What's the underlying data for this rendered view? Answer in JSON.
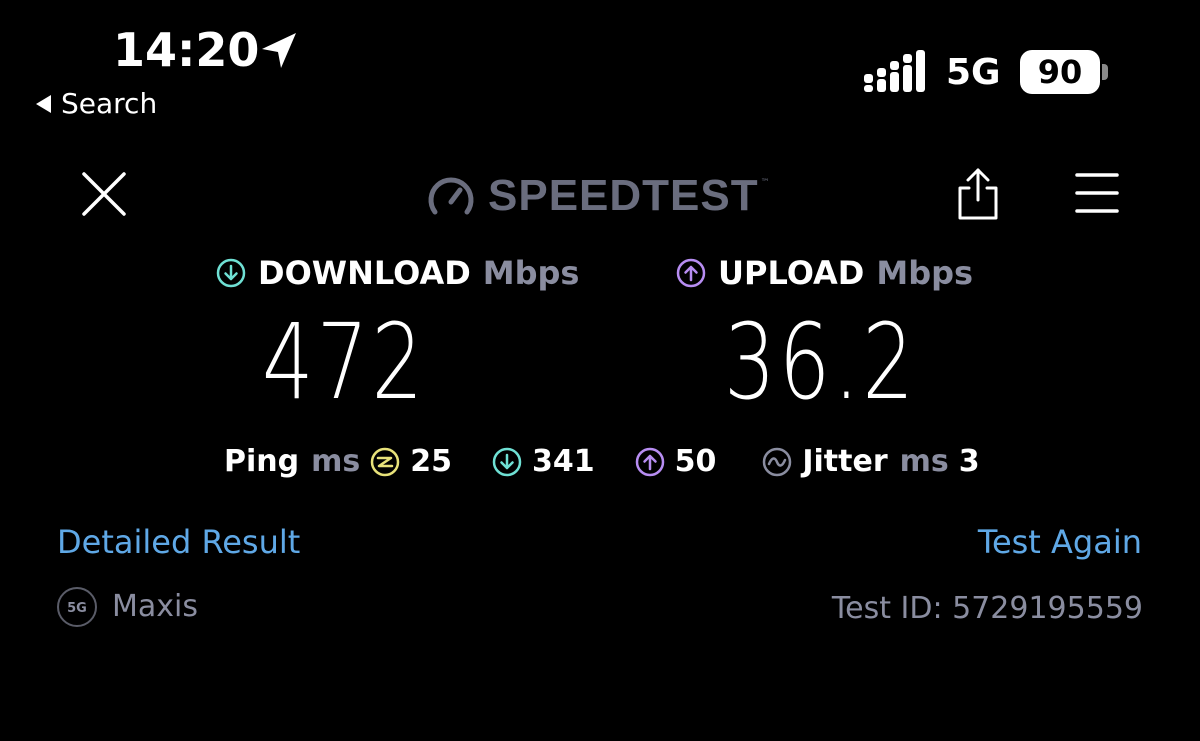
{
  "status_bar": {
    "time": "14:20",
    "back_label": "Search",
    "network": "5G",
    "battery": "90"
  },
  "toolbar": {
    "logo_text": "SPEEDTEST",
    "logo_tm": "™"
  },
  "results": {
    "download": {
      "label": "DOWNLOAD",
      "unit": "Mbps",
      "value": "472"
    },
    "upload": {
      "label": "UPLOAD",
      "unit": "Mbps",
      "value": "36.2"
    },
    "ping": {
      "label": "Ping",
      "unit": "ms",
      "idle": "25",
      "download": "341",
      "upload": "50"
    },
    "jitter": {
      "label": "Jitter",
      "unit": "ms",
      "value": "3"
    }
  },
  "links": {
    "detailed": "Detailed Result",
    "again": "Test Again"
  },
  "footer": {
    "provider_badge": "5G",
    "provider": "Maxis",
    "test_id": "Test ID: 5729195559"
  },
  "colors": {
    "background": "#000000",
    "download_accent": "#6fe0d4",
    "upload_accent": "#b78df2",
    "idle_ping_accent": "#e8e27a",
    "link": "#5fa8e6",
    "muted": "#8a8da0"
  }
}
